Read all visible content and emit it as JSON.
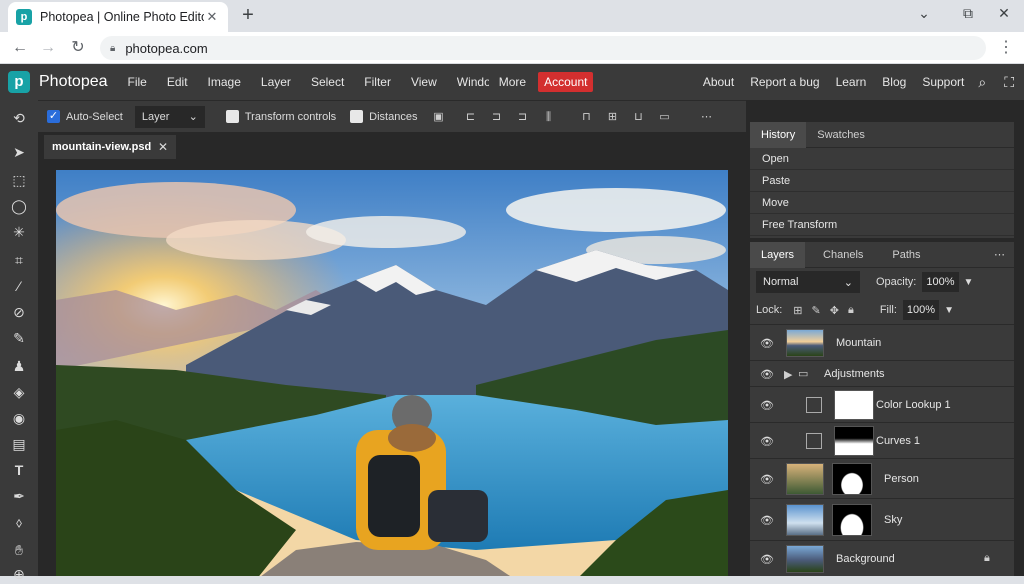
{
  "browser": {
    "tab_title": "Photopea | Online Photo Editor",
    "tab_close": "✕",
    "new_tab": "+",
    "url": "photopea.com",
    "window": {
      "minimize": "⌄",
      "restore": "⧉",
      "close": "✕"
    },
    "nav": {
      "back": "←",
      "forward": "→",
      "reload": "↻",
      "menu": "⋮"
    }
  },
  "app": {
    "name": "Photopea",
    "menu": [
      "File",
      "Edit",
      "Image",
      "Layer",
      "Select",
      "Filter",
      "View",
      "Window",
      "More",
      "Account"
    ],
    "right_menu": [
      "About",
      "Report a bug",
      "Learn",
      "Blog",
      "Support"
    ],
    "icons": {
      "search": "⌕",
      "fullscreen": "⛶"
    }
  },
  "options": {
    "auto_select_label": "Auto-Select",
    "auto_select_checked": true,
    "select_value": "Layer",
    "transform_controls_label": "Transform controls",
    "distances_label": "Distances",
    "more": "⋯"
  },
  "document": {
    "tab_name": "mountain-view.psd",
    "close": "✕"
  },
  "history": {
    "tabs": [
      "History",
      "Swatches"
    ],
    "items": [
      "Open",
      "Paste",
      "Move",
      "Free Transform"
    ]
  },
  "layers": {
    "tabs": [
      "Layers",
      "Chanels",
      "Paths"
    ],
    "more": "⋯",
    "blend_mode": "Normal",
    "opacity_label": "Opacity:",
    "opacity_value": "100%",
    "lock_label": "Lock:",
    "fill_label": "Fill:",
    "fill_value": "100%",
    "items": [
      {
        "name": "Mountain"
      },
      {
        "name": "Adjustments"
      },
      {
        "name": "Color Lookup 1"
      },
      {
        "name": "Curves 1"
      },
      {
        "name": "Person"
      },
      {
        "name": "Sky"
      },
      {
        "name": "Background"
      }
    ]
  },
  "colors": {
    "brand": "#18a2a6",
    "account": "#d32f2f",
    "panel": "#3a3a3a",
    "dark": "#282828"
  }
}
